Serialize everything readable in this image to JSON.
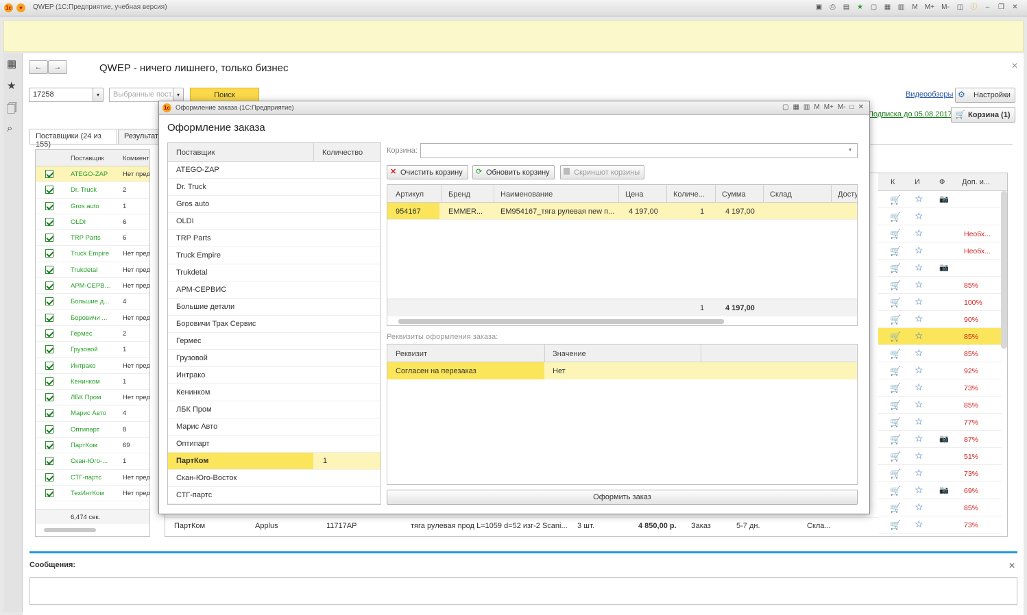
{
  "titlebar": {
    "title": "QWEP  (1С:Предприятие, учебная версия)",
    "icons": [
      "M",
      "M+",
      "M-"
    ]
  },
  "main": {
    "title": "QWEP - ничего лишнего, только бизнес",
    "search_value": "17258",
    "suppliers_placeholder": "Выбранные пост...",
    "search_button": "Поиск",
    "video_link": "Видеообзоры",
    "settings_button": "Настройки",
    "subscription_link": "Подписка до 05.08.2017",
    "cart_button": "Корзина (1)",
    "tabs": [
      "Поставщики (24 из 155)",
      "Результат"
    ]
  },
  "left_table": {
    "headers": [
      "Поставщик",
      "Коммента"
    ],
    "rows": [
      {
        "name": "ATEGO-ZAP",
        "comment": "Нет предл"
      },
      {
        "name": "Dr. Truck",
        "comment": "2"
      },
      {
        "name": "Gros auto",
        "comment": "1"
      },
      {
        "name": "OLDI",
        "comment": "6"
      },
      {
        "name": "TRP Parts",
        "comment": "6"
      },
      {
        "name": "Truck Empire",
        "comment": "Нет предл"
      },
      {
        "name": "Trukdetal",
        "comment": "Нет предл"
      },
      {
        "name": "АРМ-СЕРВ...",
        "comment": "Нет предл"
      },
      {
        "name": "Большие д...",
        "comment": "4"
      },
      {
        "name": "Боровичи ...",
        "comment": "Нет предл"
      },
      {
        "name": "Гермес",
        "comment": "2"
      },
      {
        "name": "Грузовой",
        "comment": "1"
      },
      {
        "name": "Интрако",
        "comment": "Нет предл"
      },
      {
        "name": "Кенинком",
        "comment": "1"
      },
      {
        "name": "ЛБК Пром",
        "comment": "Нет предл"
      },
      {
        "name": "Марис Авто",
        "comment": "4"
      },
      {
        "name": "Оптипарт",
        "comment": "8"
      },
      {
        "name": "ПартКом",
        "comment": "69"
      },
      {
        "name": "Скан-Юго-...",
        "comment": "1"
      },
      {
        "name": "СТГ-партс",
        "comment": "Нет предл"
      },
      {
        "name": "ТехИнтКом",
        "comment": "Нет предл"
      }
    ],
    "footer_time": "6,474 сек."
  },
  "right_table": {
    "headers": [
      "К",
      "И",
      "Ф",
      "Доп. и..."
    ],
    "rows": [
      {
        "camera": true,
        "extra": ""
      },
      {
        "camera": false,
        "extra": ""
      },
      {
        "camera": false,
        "extra": "Необх..."
      },
      {
        "camera": false,
        "extra": "Необх..."
      },
      {
        "camera": true,
        "extra": ""
      },
      {
        "camera": false,
        "extra": "85%"
      },
      {
        "camera": false,
        "extra": "100%"
      },
      {
        "camera": false,
        "extra": "90%"
      },
      {
        "camera": false,
        "extra": "85%"
      },
      {
        "camera": false,
        "extra": "85%"
      },
      {
        "camera": false,
        "extra": "92%"
      },
      {
        "camera": false,
        "extra": "73%"
      },
      {
        "camera": false,
        "extra": "85%"
      },
      {
        "camera": false,
        "extra": "77%"
      },
      {
        "camera": true,
        "extra": "87%"
      },
      {
        "camera": false,
        "extra": "51%"
      },
      {
        "camera": false,
        "extra": "73%"
      },
      {
        "camera": true,
        "extra": "69%"
      },
      {
        "camera": false,
        "extra": "85%"
      },
      {
        "camera": false,
        "extra": "73%"
      }
    ]
  },
  "bottom_row": {
    "supplier": "ПартКом",
    "brand": "Applus",
    "article": "11717AP",
    "name": "тяга рулевая прод L=1059 d=52 изг-2 Scani...",
    "qty": "3 шт.",
    "price": "4 850,00 р.",
    "type": "Заказ",
    "days": "5-7 дн.",
    "stock": "Скла..."
  },
  "messages": {
    "title": "Сообщения:"
  },
  "dialog": {
    "title": "Оформление заказа  (1С:Предприятие)",
    "heading": "Оформление заказа",
    "supplier_headers": [
      "Поставщик",
      "Количество"
    ],
    "suppliers": [
      {
        "name": "ATEGO-ZAP",
        "qty": ""
      },
      {
        "name": "Dr. Truck",
        "qty": ""
      },
      {
        "name": "Gros auto",
        "qty": ""
      },
      {
        "name": "OLDI",
        "qty": ""
      },
      {
        "name": "TRP Parts",
        "qty": ""
      },
      {
        "name": "Truck Empire",
        "qty": ""
      },
      {
        "name": "Trukdetal",
        "qty": ""
      },
      {
        "name": "АРМ-СЕРВИС",
        "qty": ""
      },
      {
        "name": "Большие детали",
        "qty": ""
      },
      {
        "name": "Боровичи Трак Сервис",
        "qty": ""
      },
      {
        "name": "Гермес",
        "qty": ""
      },
      {
        "name": "Грузовой",
        "qty": ""
      },
      {
        "name": "Интрако",
        "qty": ""
      },
      {
        "name": "Кенинком",
        "qty": ""
      },
      {
        "name": "ЛБК Пром",
        "qty": ""
      },
      {
        "name": "Марис Авто",
        "qty": ""
      },
      {
        "name": "Оптипарт",
        "qty": ""
      },
      {
        "name": "ПартКом",
        "qty": "1"
      },
      {
        "name": "Скан-Юго-Восток",
        "qty": ""
      },
      {
        "name": "СТГ-партс",
        "qty": ""
      }
    ],
    "cart_label": "Корзина:",
    "clear_cart": "Очистить корзину",
    "refresh_cart": "Обновить корзину",
    "screenshot_cart": "Скриншот корзины",
    "cart_headers": [
      "Артикул",
      "Бренд",
      "Наименование",
      "Цена",
      "Количе...",
      "Сумма",
      "Склад",
      "Досту"
    ],
    "cart_row": {
      "article": "954167",
      "brand": "EMMER...",
      "name": "EM954167_тяга рулевая new п...",
      "price": "4 197,00",
      "qty": "1",
      "sum": "4 197,00"
    },
    "cart_total": {
      "qty": "1",
      "sum": "4 197,00"
    },
    "requisites_label": "Реквизиты оформления заказа:",
    "req_headers": [
      "Реквизит",
      "Значение"
    ],
    "req_row": {
      "name": "Согласен на перезаказ",
      "value": "Нет"
    },
    "submit": "Оформить заказ"
  }
}
